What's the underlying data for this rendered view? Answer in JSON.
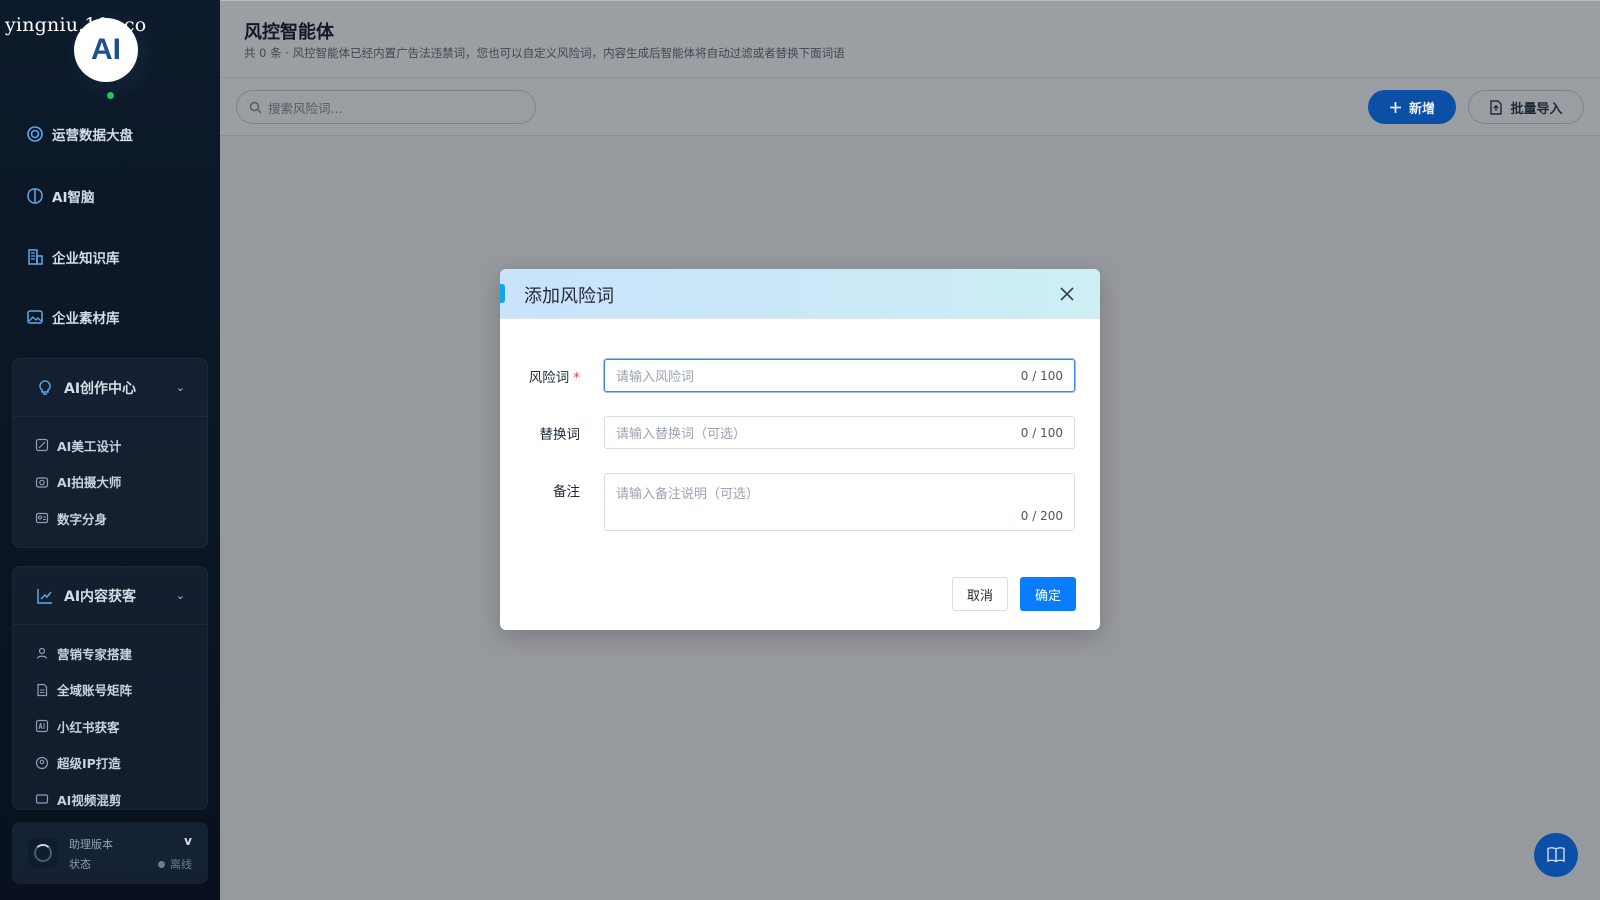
{
  "watermark": "yingniu.10v.co",
  "logo": {
    "text": "AI"
  },
  "sidebar": {
    "items": [
      {
        "label": "运营数据大盘",
        "icon": "dashboard-icon"
      },
      {
        "label": "AI智脑",
        "icon": "brain-icon"
      },
      {
        "label": "企业知识库",
        "icon": "building-icon"
      },
      {
        "label": "企业素材库",
        "icon": "image-icon"
      }
    ],
    "groups": [
      {
        "label": "AI创作中心",
        "icon": "lightbulb-icon",
        "items": [
          {
            "label": "AI美工设计",
            "icon": "design-icon"
          },
          {
            "label": "AI拍摄大师",
            "icon": "camera-icon"
          },
          {
            "label": "数字分身",
            "icon": "id-card-icon"
          }
        ]
      },
      {
        "label": "AI内容获客",
        "icon": "chart-line-icon",
        "items": [
          {
            "label": "营销专家搭建",
            "icon": "user-icon"
          },
          {
            "label": "全域账号矩阵",
            "icon": "document-icon"
          },
          {
            "label": "小红书获客",
            "icon": "ai-badge-icon"
          },
          {
            "label": "超级IP打造",
            "icon": "avatar-icon"
          },
          {
            "label": "AI视频混剪",
            "icon": "video-icon"
          }
        ]
      }
    ],
    "footer": {
      "version_label": "助理版本",
      "version_value": "v",
      "status_label": "状态",
      "status_value": "离线"
    }
  },
  "page": {
    "title": "风控智能体",
    "description": "共 0 条 · 风控智能体已经内置广告法违禁词，您也可以自定义风险词，内容生成后智能体将自动过滤或者替换下面词语"
  },
  "toolbar": {
    "search_placeholder": "搜索风险词...",
    "add_label": "新增",
    "import_label": "批量导入"
  },
  "modal": {
    "title": "添加风险词",
    "fields": {
      "risk_word": {
        "label": "风险词",
        "required_mark": "*",
        "placeholder": "请输入风险词",
        "count": "0 / 100"
      },
      "replacement": {
        "label": "替换词",
        "placeholder": "请输入替换词（可选）",
        "count": "0 / 100"
      },
      "note": {
        "label": "备注",
        "placeholder": "请输入备注说明（可选）",
        "count": "0 / 200"
      }
    },
    "cancel_label": "取消",
    "confirm_label": "确定"
  },
  "colors": {
    "primary": "#0a7cff",
    "sidebar_bg": "#0d1a2b",
    "online": "#22c55e",
    "required": "#ef4444"
  }
}
